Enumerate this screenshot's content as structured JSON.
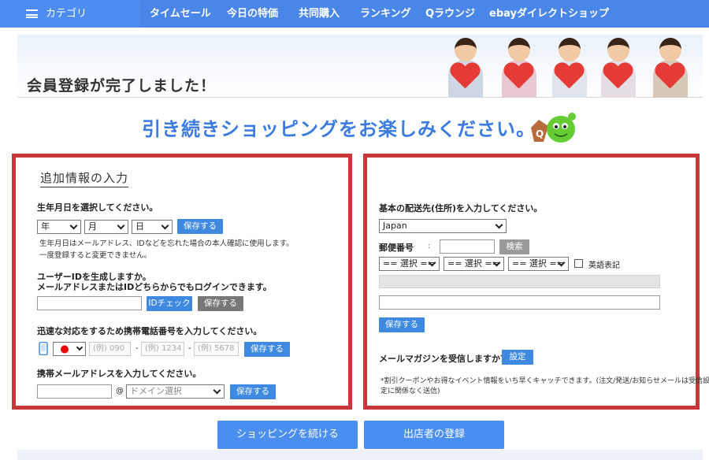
{
  "nav": {
    "category": "カテゴリ",
    "items": [
      "タイムセール",
      "今日の特価",
      "共同購入",
      "ランキング",
      "Qラウンジ",
      "ebayダイレクトショップ"
    ]
  },
  "banner": {
    "title": "会員登録が完了しました！"
  },
  "subtitle": "引き続きショッピングをお楽しみください。",
  "left": {
    "title": "追加情報の入力",
    "birth_label": "生年月日を選択してください。",
    "year": "年",
    "month": "月",
    "day": "日",
    "save": "保存する",
    "birth_note1": "生年月日はメールアドレス、IDなどを忘れた場合の本人確認に使用します。",
    "birth_note2": "一度登録すると変更できません。",
    "uid_label1": "ユーザーIDを生成しますか。",
    "uid_label2": "メールアドレスまたはIDどちらからでもログインできます。",
    "id_check": "IDチェック",
    "phone_label": "迅速な対応をするため携帯電話番号を入力してください。",
    "phone_ph1": "(例) 090",
    "phone_ph2": "(例) 1234",
    "phone_ph3": "(例) 5678",
    "dash": "-",
    "mail_label": "携帯メールアドレスを入力してください。",
    "at": "@",
    "domain_select": "ドメイン選択"
  },
  "right": {
    "addr_label": "基本の配送先(住所)を入力してください。",
    "country": "Japan",
    "zip_label": "郵便番号",
    "colon": ":",
    "search": "検索",
    "select1": "== 選択 ==",
    "select2": "== 選択 ==",
    "select3": "== 選択 ==",
    "english": "英語表記",
    "save": "保存する",
    "magazine_label": "メールマガジンを受信しますか？",
    "setting": "設定",
    "magazine_note1": "*割引クーポンやお得なイベント情報をいち早くキャッチできます。(注文/発送/お知らせメールは受信設",
    "magazine_note2": "定に関係なく送信)"
  },
  "buttons": {
    "continue": "ショッピングを続ける",
    "seller": "出店者の登録"
  },
  "colors": {
    "nav": "#4a86e8",
    "accent": "#3f8ae0",
    "panel_border": "#c9373a",
    "subtitle": "#3b7be0"
  }
}
